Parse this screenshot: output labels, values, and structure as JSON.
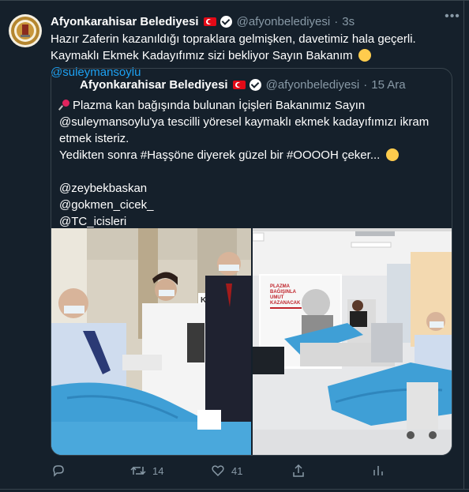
{
  "tweet": {
    "author_name": "Afyonkarahisar Belediyesi",
    "handle": "@afyonbelediyesi",
    "separator": "·",
    "time": "3s",
    "text_line1": "Hazır Zaferin kazanıldığı topraklara gelmişken, davetimiz hala geçerli.",
    "text_line2": "Kaymaklı Ekmek Kadayıfımız sizi bekliyor Sayın Bakanım",
    "mention": "@suleymansoylu"
  },
  "quoted": {
    "author_name": "Afyonkarahisar Belediyesi",
    "handle": "@afyonbelediyesi",
    "separator": "·",
    "time": "15 Ara",
    "line1": "Plazma kan bağışında bulunan İçişleri Bakanımız Sayın",
    "line2": "@suleymansoylu'ya tescilli yöresel kaymaklı ekmek kadayıfımızı ikram",
    "line3": "etmek isteriz.",
    "line4": "Yedikten sonra #Haşşöne diyerek güzel bir #OOOOH çeker...",
    "mention1": "@zeybekbaskan",
    "mention2": "@gokmen_cicek_",
    "mention3": "@TC_icisleri",
    "photo_left_sign": "KI",
    "poster_line1": "PLAZMA",
    "poster_line2": "BAĞIŞINLA",
    "poster_line3": "UMUT",
    "poster_line4": "KAZANACAK"
  },
  "actions": {
    "retweet_count": "14",
    "like_count": "41"
  },
  "icons": [
    "reply-icon",
    "retweet-icon",
    "like-icon",
    "share-icon",
    "analytics-icon",
    "more-icon",
    "verified-icon",
    "flag-tr-icon",
    "pushpin-icon",
    "smile-emoji",
    "wink-emoji"
  ],
  "colors": {
    "background": "#15202b",
    "border": "#38444d",
    "secondary_text": "#8899a6",
    "link": "#1da1f2",
    "flag_red": "#e30a17"
  }
}
